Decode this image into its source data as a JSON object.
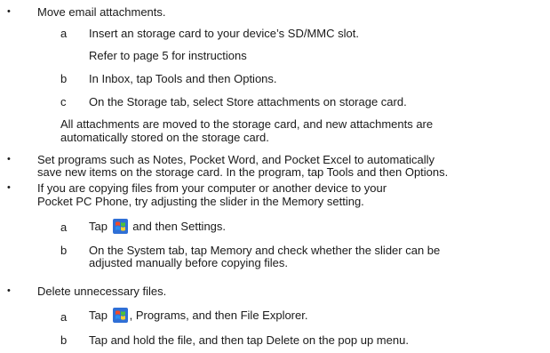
{
  "items": [
    {
      "bullet": "•",
      "text": "Move email attachments.",
      "steps": [
        {
          "letter": "a",
          "text": "Insert an storage card to your device’s SD/MMC slot."
        },
        {
          "letter": "",
          "text": "Refer to page 5 for instructions"
        },
        {
          "letter": "b",
          "text": "In Inbox, tap Tools and then Options."
        },
        {
          "letter": "c",
          "text": "On the Storage tab, select Store attachments on storage card."
        }
      ],
      "note": [
        "All attachments are moved to the storage card, and new attachments are",
        "automatically stored on the storage card."
      ]
    },
    {
      "bullet": "•",
      "lines": [
        "Set programs such as Notes, Pocket Word, and Pocket Excel to automatically",
        "save new items on the storage card. In the program, tap Tools and then Options."
      ]
    },
    {
      "bullet": "•",
      "lines": [
        "If you are copying files from your computer or another device to your",
        "Pocket PC Phone, try adjusting the slider in the Memory setting."
      ],
      "steps": [
        {
          "letter": "a",
          "pre": "Tap",
          "icon": "windows-start-icon",
          "post": "and then Settings."
        },
        {
          "letter": "b",
          "lines": [
            "On the System tab, tap Memory and check whether the slider can be",
            "adjusted manually before copying files."
          ]
        }
      ]
    },
    {
      "bullet": "•",
      "text": "Delete unnecessary files.",
      "steps": [
        {
          "letter": "a",
          "pre": "Tap",
          "icon": "windows-start-icon",
          "post": ", Programs, and then File Explorer."
        },
        {
          "letter": "b",
          "text": "Tap and hold the file, and then tap Delete on the pop up menu."
        }
      ]
    }
  ]
}
